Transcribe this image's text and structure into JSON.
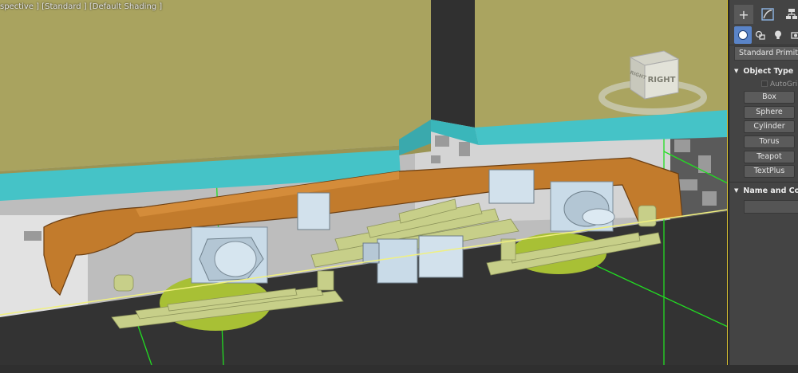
{
  "viewport": {
    "label": "spective ] [Standard ] [Default Shading ]",
    "viewcube_face": "RIGHT",
    "viewcube_side": "RIGHT"
  },
  "command_panel": {
    "tabs": [
      {
        "icon": "create-plus-icon",
        "glyph": "+"
      },
      {
        "icon": "modify-icon",
        "glyph": ""
      },
      {
        "icon": "hierarchy-icon",
        "glyph": ""
      }
    ],
    "subtabs": [
      {
        "icon": "geometry-sphere-icon"
      },
      {
        "icon": "shapes-icon"
      },
      {
        "icon": "lights-icon"
      },
      {
        "icon": "cameras-icon"
      }
    ],
    "primitive_dropdown": "Standard Primitive",
    "object_type_title": "Object Type",
    "autogrid_label": "AutoGri",
    "object_buttons": [
      "Box",
      "Sphere",
      "Cylinder",
      "Torus",
      "Teapot",
      "TextPlus"
    ],
    "name_color_title": "Name and Colo"
  },
  "colors": {
    "tank": "#a9a35f",
    "cyan_trim": "#45c3c7",
    "frame_orange": "#c27b2c",
    "parts_light": "#c9dbe8",
    "springs": "#c7cf89",
    "wheels": "#a8c035",
    "selection_green": "#22dd22",
    "ground_dark": "#333333",
    "active_tab_blue": "#5a84c8"
  }
}
